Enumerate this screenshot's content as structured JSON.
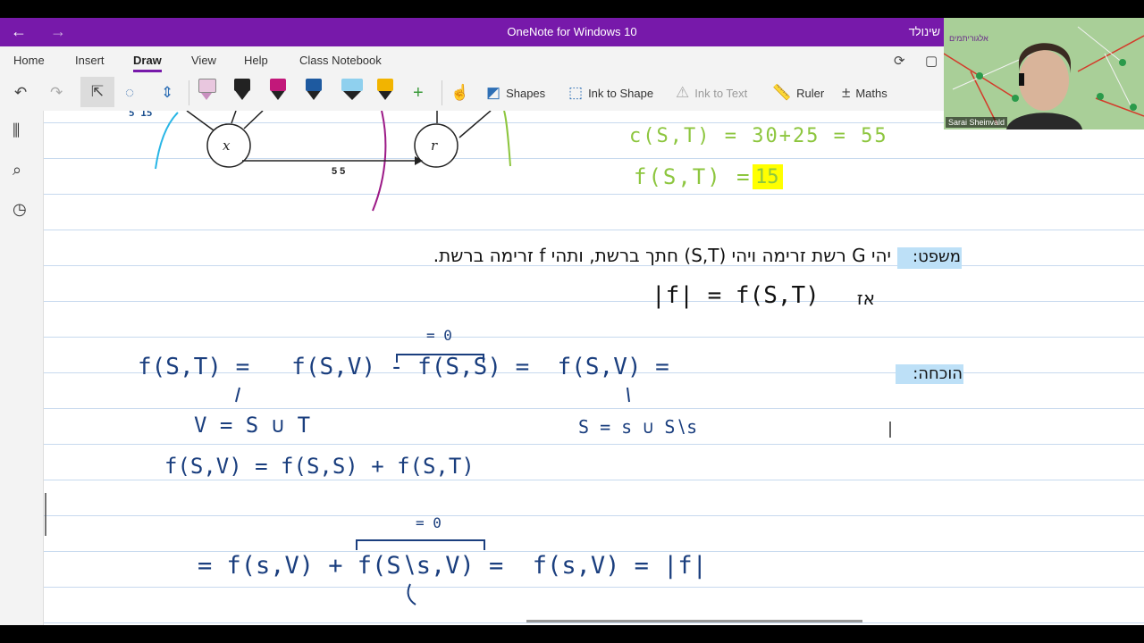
{
  "window": {
    "title": "OneNote for Windows 10",
    "user_name": "שינולד"
  },
  "ribbon": {
    "tabs": [
      "Home",
      "Insert",
      "Draw",
      "View",
      "Help",
      "Class Notebook"
    ],
    "active_tab": "Draw"
  },
  "toolbar": {
    "shapes": "Shapes",
    "ink_to_shape": "Ink to Shape",
    "ink_to_text": "Ink to Text",
    "ruler": "Ruler",
    "maths": "Maths",
    "pens": [
      {
        "color": "#d8a8d0",
        "name": "pink-highlighter"
      },
      {
        "color": "#1e1e1e",
        "name": "black-pen-1"
      },
      {
        "color": "#c2187a",
        "name": "magenta-pen"
      },
      {
        "color": "#1e5aa0",
        "name": "blue-pen"
      },
      {
        "color": "#7ec8e8",
        "name": "lightblue-highlighter"
      },
      {
        "color": "#f2b400",
        "name": "yellow-pen"
      }
    ]
  },
  "webcam": {
    "name": "Sarai Sheinvald",
    "banner": "אלגוריתמים"
  },
  "notes": {
    "edge_label": "5 5",
    "top_left_label": "5 15",
    "node_x": "x",
    "node_r": "r",
    "capacity_eq": "c(S,T) = 30+25 = 55",
    "flow_eq_label": "f(S,T) =",
    "flow_value": "15",
    "lemma_label": "משפט:",
    "lemma_text": "יהי G רשת זרימה ויהי (S,T) חתך ברשת, ותהי f זרימה ברשת.",
    "lemma_then": "אז",
    "lemma_result": "|f| = f(S,T)",
    "proof_label": "הוכחה:",
    "line1": "f(S,T) =   f(S,V) - f(S,S) =  f(S,V) =",
    "overbrace1": "= 0",
    "v_def": "V = S ∪ T",
    "s_def": "S = s ∪ S∖s",
    "line2": "f(S,V) = f(S,S) + f(S,T)",
    "line3": "= f(s,V) + f(S∖s,V) =  f(s,V) = |f|",
    "overbrace2": "= 0"
  }
}
